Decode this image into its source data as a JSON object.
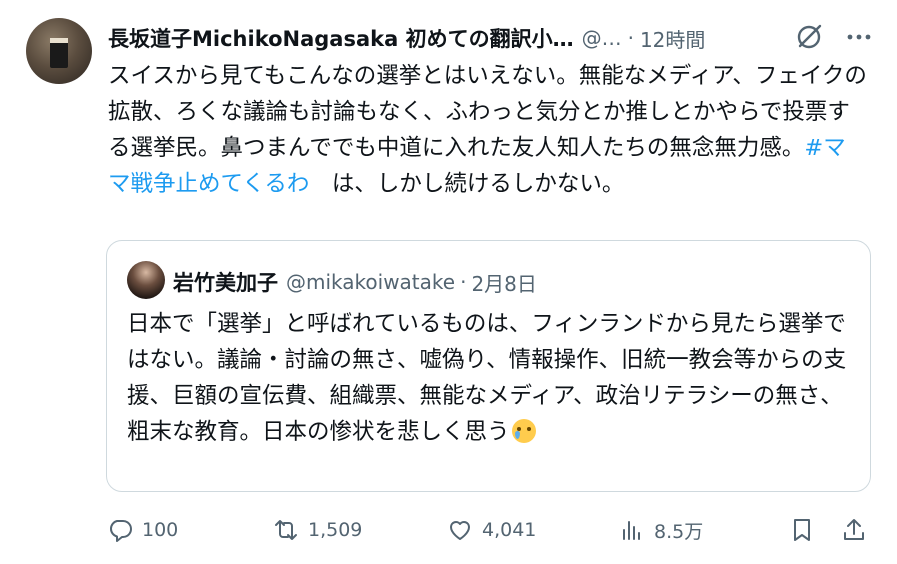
{
  "author": {
    "display_name": "長坂道子MichikoNagasaka 初めての翻訳小…",
    "handle": "@…",
    "separator": "·",
    "time": "12時間"
  },
  "tweet": {
    "text_before": "スイスから見てもこんなの選挙とはいえない。無能なメディア、フェイクの拡散、ろくな議論も討論もなく、ふわっと気分とか推しとかやらで投票する選挙民。鼻つまんででも中道に入れた友人知人たちの無念無力感。",
    "hashtag": "#ママ戦争止めてくるわ",
    "text_after": "は、しかし続けるしかない。"
  },
  "quote": {
    "display_name": "岩竹美加子",
    "handle": "@mikakoiwatake",
    "separator": "·",
    "time": "2月8日",
    "text": "日本で「選挙」と呼ばれているものは、フィンランドから見たら選挙ではない。議論・討論の無さ、嘘偽り、情報操作、旧統一教会等からの支援、巨額の宣伝費、組織票、無能なメディア、政治リテラシーの無さ、粗末な教育。日本の惨状を悲しく思う",
    "emoji": "crying-face"
  },
  "actions": {
    "replies": "100",
    "reposts": "1,509",
    "likes": "4,041",
    "views": "8.5万"
  },
  "colors": {
    "text": "#0f1419",
    "secondary": "#536471",
    "link": "#1d9bf0",
    "border": "#cfd9de"
  }
}
